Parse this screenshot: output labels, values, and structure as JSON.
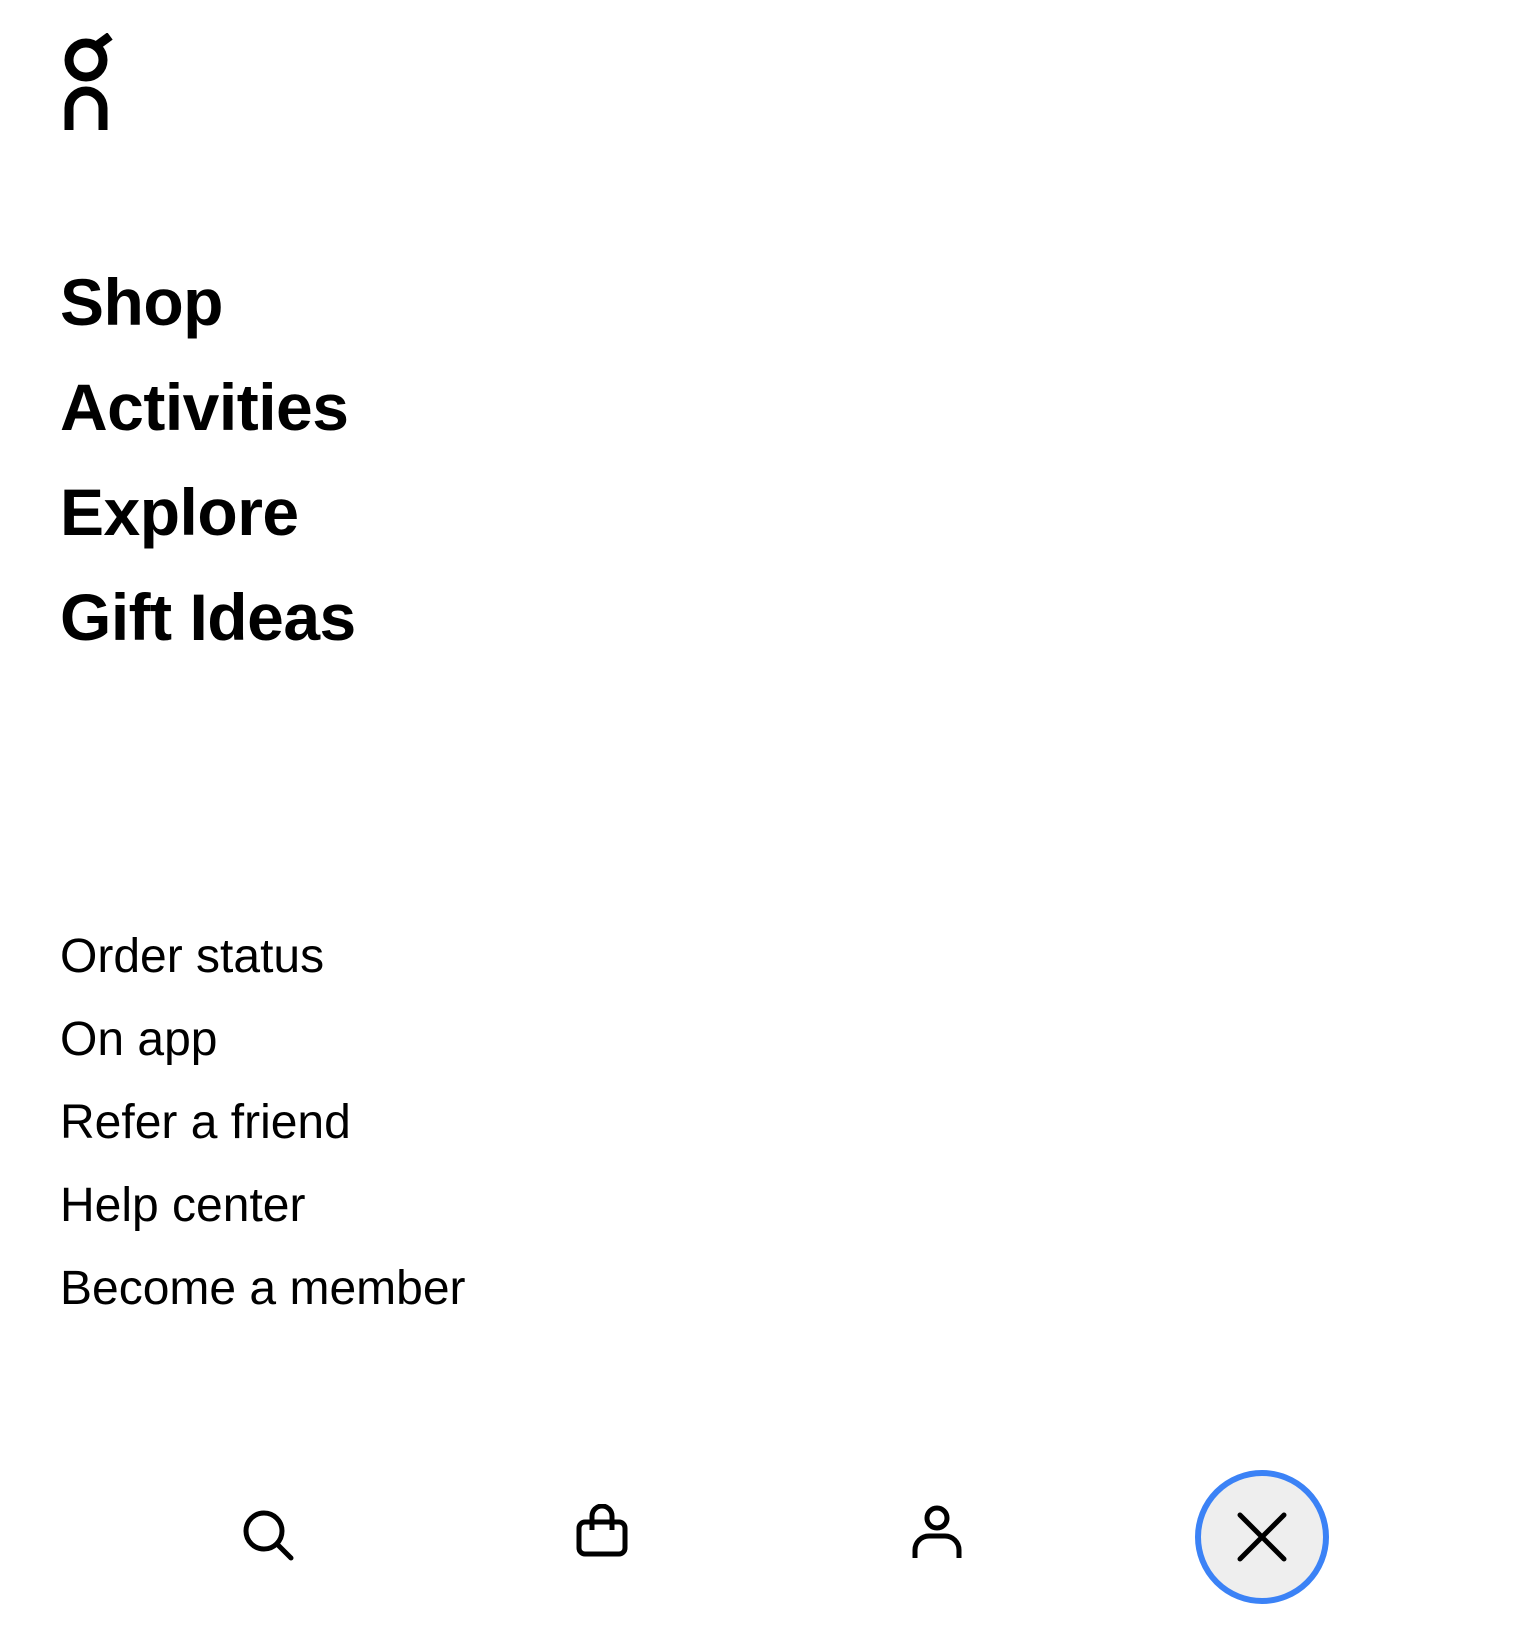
{
  "brand": {
    "logo_icon": "on-logo-icon"
  },
  "primary_nav": {
    "items": [
      {
        "label": "Shop"
      },
      {
        "label": "Activities"
      },
      {
        "label": "Explore"
      },
      {
        "label": "Gift Ideas"
      }
    ]
  },
  "secondary_nav": {
    "items": [
      {
        "label": "Order status"
      },
      {
        "label": "On app"
      },
      {
        "label": "Refer a friend"
      },
      {
        "label": "Help center"
      },
      {
        "label": "Become a member"
      }
    ]
  },
  "bottom_bar": {
    "icons": [
      "search-icon",
      "shopping-bag-icon",
      "user-icon",
      "close-icon"
    ]
  },
  "colors": {
    "text": "#000000",
    "background": "#ffffff",
    "focus_ring": "#3b82f6",
    "close_button_bg": "#eeeeee"
  }
}
